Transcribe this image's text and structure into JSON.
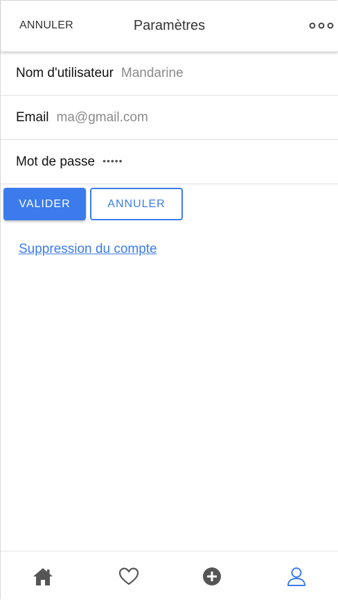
{
  "header": {
    "cancel_label": "ANNULER",
    "title": "Paramètres",
    "more_icon": "more-horizontal-icon"
  },
  "form": {
    "username": {
      "label": "Nom d'utilisateur",
      "value": "Mandarine"
    },
    "email": {
      "label": "Email",
      "value": "ma@gmail.com"
    },
    "password": {
      "label": "Mot de passe",
      "value": "•••••"
    }
  },
  "actions": {
    "validate_label": "VALIDER",
    "cancel_label": "ANNULER"
  },
  "links": {
    "delete_account": "Suppression du compte"
  },
  "bottom_nav": {
    "items": [
      {
        "icon": "home-icon",
        "active": false
      },
      {
        "icon": "heart-icon",
        "active": false
      },
      {
        "icon": "add-circle-icon",
        "active": false
      },
      {
        "icon": "user-icon",
        "active": true
      }
    ]
  },
  "colors": {
    "accent": "#3b7bec",
    "inactive_icon": "#555555"
  }
}
